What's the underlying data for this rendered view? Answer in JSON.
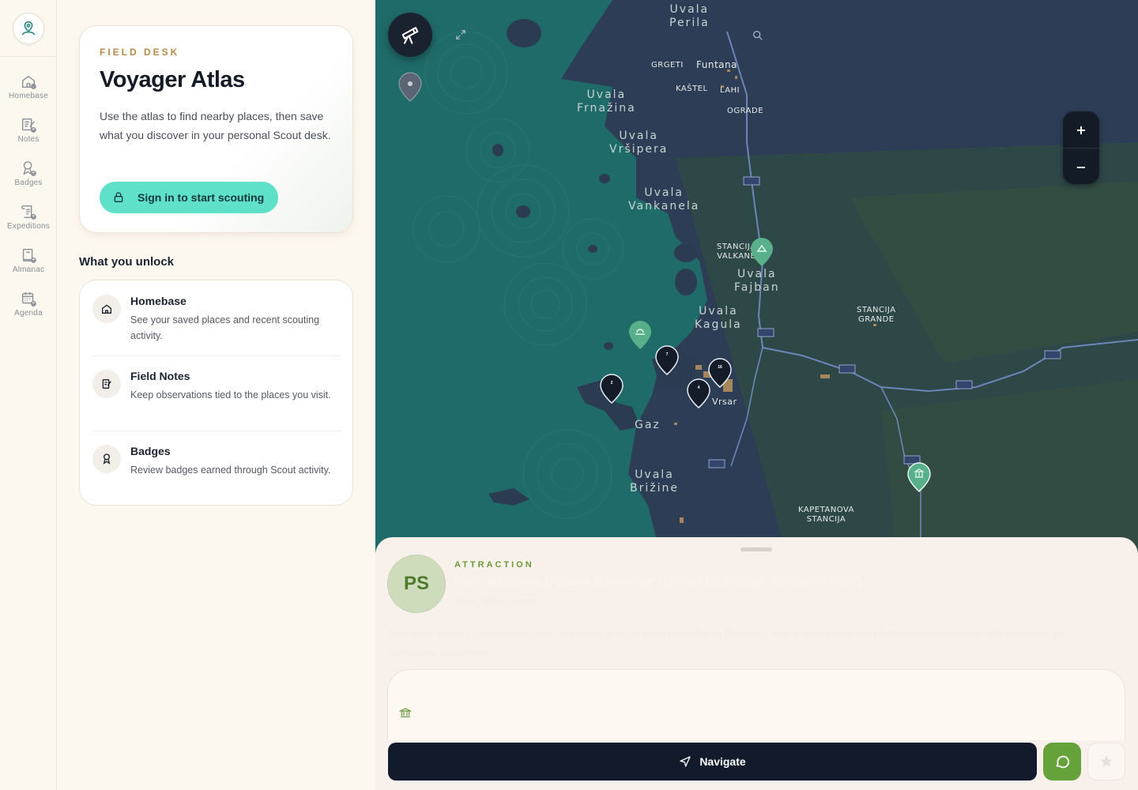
{
  "rail": {
    "items": [
      {
        "label": "Homebase",
        "icon": "home-icon"
      },
      {
        "label": "Notes",
        "icon": "notes-icon"
      },
      {
        "label": "Badges",
        "icon": "badge-icon"
      },
      {
        "label": "Expeditions",
        "icon": "scroll-icon"
      },
      {
        "label": "Almanac",
        "icon": "book-icon"
      },
      {
        "label": "Agenda",
        "icon": "calendar-icon"
      }
    ]
  },
  "hero": {
    "eyebrow": "FIELD DESK",
    "title": "Voyager Atlas",
    "text": "Use the atlas to find nearby places, then save what you discover in your personal Scout desk.",
    "signin_label": "Sign in to start scouting"
  },
  "unlock": {
    "heading": "What you unlock",
    "items": [
      {
        "title": "Homebase",
        "desc": "See your saved places and recent scouting activity."
      },
      {
        "title": "Field Notes",
        "desc": "Keep observations tied to the places you visit."
      },
      {
        "title": "Badges",
        "desc": "Review badges earned through Scout activity."
      }
    ]
  },
  "map": {
    "labels": {
      "perila": "Uvala\nPerila",
      "frnazina": "Uvala\nFrnažina",
      "vrsipera": "Uvala\nVršipera",
      "vankanela": "Uvala\nVankanela",
      "fajban": "Uvala\nFajban",
      "kagula": "Uvala\nKagula",
      "gaz": "Gaz",
      "brizine": "Uvala\nBrižine",
      "grgeti": "GRGETI",
      "funtana": "Funtana",
      "kastel": "KAŠTEL",
      "lahi": "LAHI",
      "ograde": "OGRADE",
      "stancija_valkane": "STANCIJA\nVALKANE",
      "stancija_grande": "STANCIJA\nGRANDE",
      "kapetanova": "KAPETANOVA\nSTANCIJA",
      "vrsar": "Vrsar"
    },
    "zoom_in": "+",
    "zoom_out": "−",
    "cluster_pins": [
      "7",
      "16",
      "4",
      "2"
    ]
  },
  "sheet": {
    "avatar": "PS",
    "category": "ATTRACTION",
    "title": "Park skulptura Dušana Džamonje (Dusan Dzamonja Sculpture Park)",
    "subtitle": "Vrsar, Istria, Croatia",
    "description": "A sculpture park on a hillside near Vrsar, displaying works of the sculptor Dušan Džamonja among olive groves and Mediterranean vegetation, with views over the surrounding countryside.",
    "navigate_label": "Navigate"
  }
}
